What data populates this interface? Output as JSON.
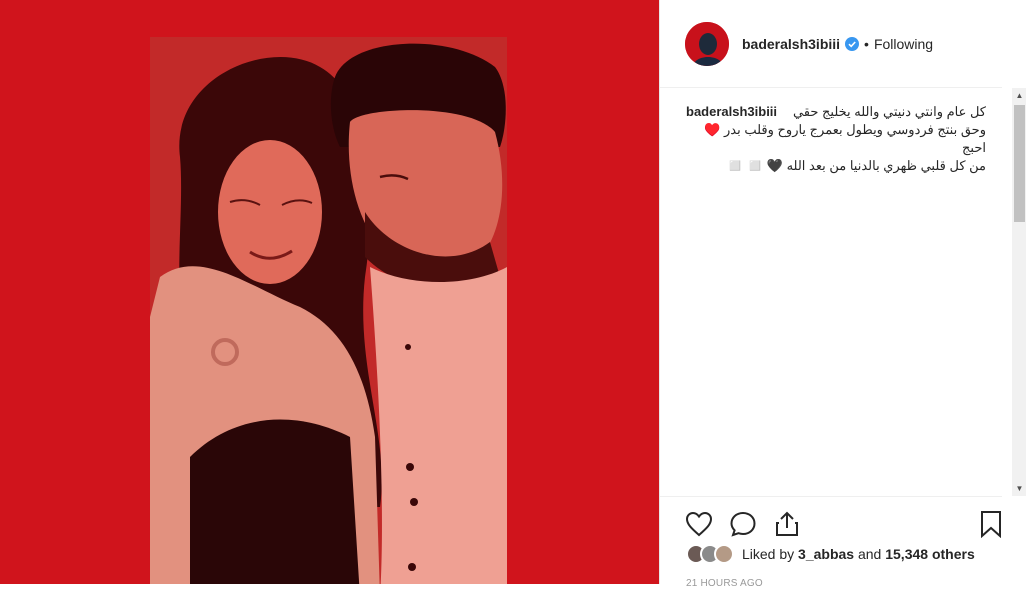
{
  "post": {
    "username": "baderalsh3ibiii",
    "follow_status": "Following",
    "dot": "•",
    "caption_user": "baderalsh3ibiii",
    "caption_lines": [
      "كل عام وانتي دنيتي والله يخليج حقي",
      "وحق بنتج فردوسي ويطول بعمرج ياروح وقلب بدر ♥️ احبج",
      "من كل قلبي ظهري بالدنيا من بعد الله 🖤 ◻️ ◻️"
    ],
    "liked_by_prefix": "Liked by",
    "liked_by_user": "3_abbas",
    "liked_by_and": "and",
    "liked_by_count": "15,348 others",
    "timestamp": "21 HOURS AGO"
  },
  "colors": {
    "media_background": "#d0141c",
    "verified_blue": "#3897f0"
  },
  "icons": {
    "like": "heart-icon",
    "comment": "comment-icon",
    "share": "share-icon",
    "save": "bookmark-icon",
    "verified": "verified-badge-icon"
  }
}
